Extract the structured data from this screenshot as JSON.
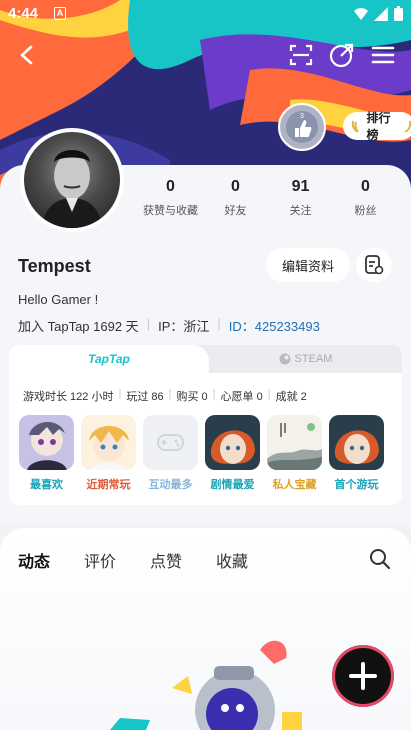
{
  "status_bar": {
    "time": "4:44",
    "badge": "A"
  },
  "header": {
    "rank_label": "排行榜",
    "badge_level": "3"
  },
  "profile": {
    "stats": [
      {
        "value": "0",
        "label": "获赞与收藏"
      },
      {
        "value": "0",
        "label": "好友"
      },
      {
        "value": "91",
        "label": "关注"
      },
      {
        "value": "0",
        "label": "粉丝"
      }
    ],
    "name": "Tempest",
    "edit_label": "编辑资料",
    "bio": "Hello Gamer !",
    "joined": "加入 TapTap 1692 天",
    "ip": "IP：浙江",
    "id": "ID：425233493"
  },
  "games": {
    "tab_taptap": "TapTap",
    "tab_steam": "STEAM",
    "stats": [
      "游戏时长 122 小时",
      "玩过 86",
      "购买 0",
      "心愿单 0",
      "成就 2"
    ],
    "items": [
      {
        "label": "最喜欢",
        "color": "#1aa5b8"
      },
      {
        "label": "近期常玩",
        "color": "#e05a3a"
      },
      {
        "label": "互动最多",
        "color": "#8ab4d8"
      },
      {
        "label": "剧情最爱",
        "color": "#1aa5b8"
      },
      {
        "label": "私人宝藏",
        "color": "#e0a020"
      },
      {
        "label": "首个游玩",
        "color": "#1aa5b8"
      }
    ]
  },
  "feed_tabs": [
    "动态",
    "评价",
    "点赞",
    "收藏"
  ],
  "colors": {
    "accent": "#15c5ce",
    "id_link": "#1f6fb5"
  }
}
